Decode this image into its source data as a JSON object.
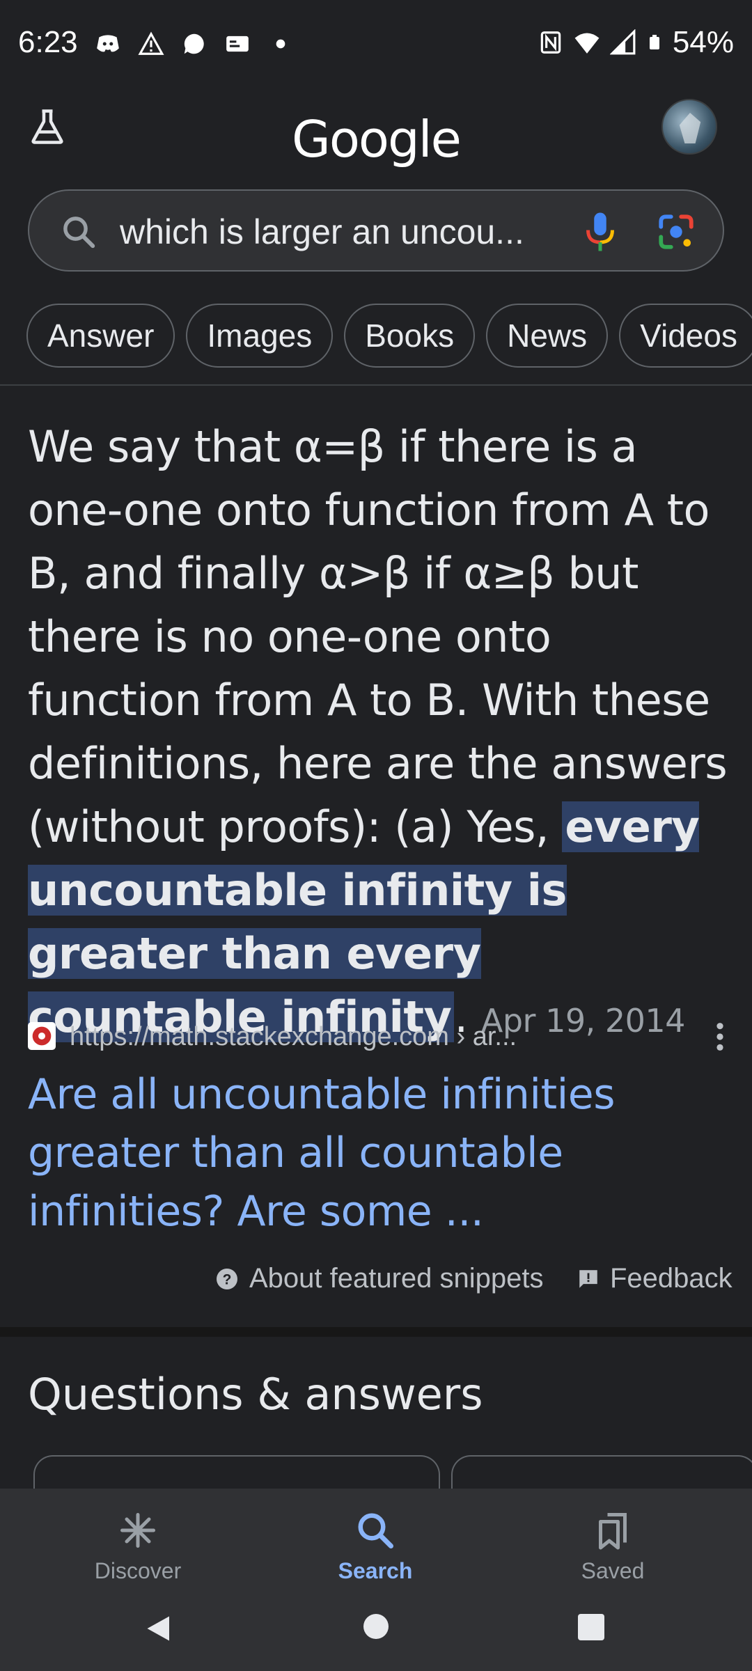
{
  "status_bar": {
    "time": "6:23",
    "battery": "54%"
  },
  "header": {
    "logo": "Google"
  },
  "search": {
    "query": "which is larger an uncou..."
  },
  "chips": [
    "Answer",
    "Images",
    "Books",
    "News",
    "Videos"
  ],
  "snippet": {
    "text_before": "We say that α=β if there is a one-one onto function from A to B, and finally α>β if α≥β but there is no one-one onto function from A to B. With these definitions, here are the answers (without proofs): (a) Yes, ",
    "highlight": "every uncountable infinity is greater than every countable infinity",
    "text_after": ".",
    "date": "Apr 19, 2014"
  },
  "result": {
    "url": "https://math.stackexchange.com › ar...",
    "title": "Are all uncountable infinities greater than all countable infinities? Are some ..."
  },
  "footer_links": {
    "about": "About featured snippets",
    "feedback": "Feedback"
  },
  "qa": {
    "heading": "Questions & answers"
  },
  "bottom_nav": {
    "discover": "Discover",
    "search": "Search",
    "saved": "Saved"
  },
  "colors": {
    "background": "#202124",
    "link": "#8ab4f8",
    "highlight": "#2f4166"
  }
}
